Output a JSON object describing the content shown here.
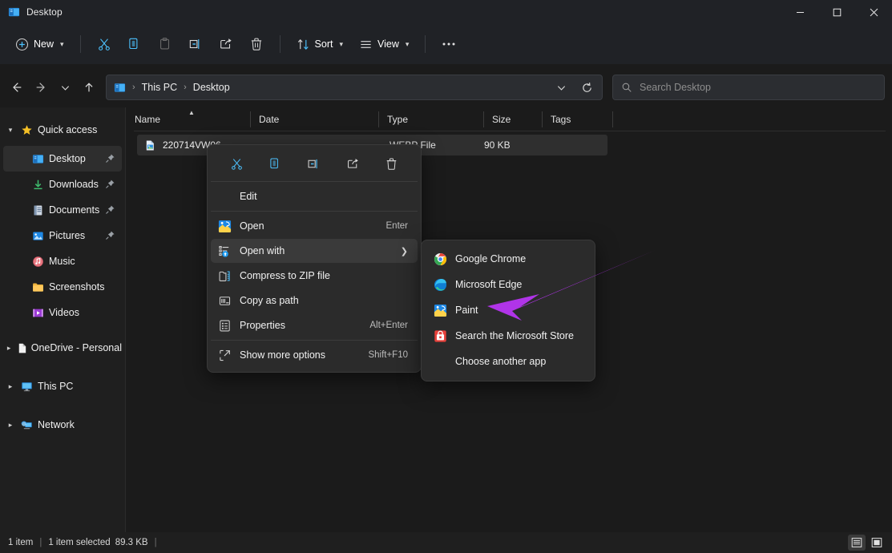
{
  "window": {
    "title": "Desktop",
    "app_icon": "desktop-folder-icon",
    "controls": {
      "minimize": "Minimize",
      "maximize": "Maximize",
      "close": "Close"
    }
  },
  "toolbar": {
    "new_label": "New",
    "items": [
      {
        "name": "cut",
        "label": "Cut"
      },
      {
        "name": "copy",
        "label": "Copy"
      },
      {
        "name": "paste",
        "label": "Paste"
      },
      {
        "name": "rename",
        "label": "Rename"
      },
      {
        "name": "share",
        "label": "Share"
      },
      {
        "name": "delete",
        "label": "Delete"
      }
    ],
    "sort_label": "Sort",
    "view_label": "View",
    "more_label": "See more"
  },
  "addressbar": {
    "back": "Back",
    "forward": "Forward",
    "recent": "Recent locations",
    "up": "Up to This PC",
    "crumbs": [
      "This PC",
      "Desktop"
    ],
    "separator": "›",
    "dropdown": "Previous locations",
    "refresh": "Refresh"
  },
  "search": {
    "placeholder": "Search Desktop",
    "icon": "search-icon"
  },
  "sidebar": {
    "groups": [
      {
        "name": "quick-access",
        "label": "Quick access",
        "icon": "star-icon",
        "expanded": true,
        "items": [
          {
            "label": "Desktop",
            "icon": "desktop-icon",
            "pinned": true,
            "selected": true
          },
          {
            "label": "Downloads",
            "icon": "download-icon",
            "pinned": true,
            "selected": false
          },
          {
            "label": "Documents",
            "icon": "documents-icon",
            "pinned": true,
            "selected": false
          },
          {
            "label": "Pictures",
            "icon": "pictures-icon",
            "pinned": true,
            "selected": false
          },
          {
            "label": "Music",
            "icon": "music-icon",
            "pinned": false,
            "selected": false
          },
          {
            "label": "Screenshots",
            "icon": "folder-icon",
            "pinned": false,
            "selected": false
          },
          {
            "label": "Videos",
            "icon": "videos-icon",
            "pinned": false,
            "selected": false
          }
        ]
      },
      {
        "name": "onedrive",
        "label": "OneDrive - Personal",
        "icon": "onedrive-icon",
        "expanded": false,
        "items": []
      },
      {
        "name": "this-pc",
        "label": "This PC",
        "icon": "thispc-icon",
        "expanded": false,
        "items": []
      },
      {
        "name": "network",
        "label": "Network",
        "icon": "network-icon",
        "expanded": false,
        "items": []
      }
    ]
  },
  "filelist": {
    "columns": [
      {
        "label": "Name",
        "sorted": true,
        "sort_dir": "asc"
      },
      {
        "label": "Date",
        "sorted": false
      },
      {
        "label": "Type",
        "sorted": false
      },
      {
        "label": "Size",
        "sorted": false
      },
      {
        "label": "Tags",
        "sorted": false
      }
    ],
    "rows": [
      {
        "name": "220714VW06",
        "icon": "webp-file-icon",
        "type": "WEBP File",
        "size": "90 KB",
        "tags": "",
        "selected": true
      }
    ]
  },
  "context_menu": {
    "toolbar": [
      {
        "name": "cut",
        "label": "Cut"
      },
      {
        "name": "copy",
        "label": "Copy"
      },
      {
        "name": "rename",
        "label": "Rename"
      },
      {
        "name": "share",
        "label": "Share"
      },
      {
        "name": "delete",
        "label": "Delete"
      }
    ],
    "items": [
      {
        "label": "Edit",
        "icon": "",
        "accel": "",
        "submenu": false,
        "highlighted": false,
        "divider_after": true
      },
      {
        "label": "Open",
        "icon": "paint-icon",
        "accel": "Enter",
        "submenu": false,
        "highlighted": false,
        "divider_after": false
      },
      {
        "label": "Open with",
        "icon": "open-with-icon",
        "accel": "",
        "submenu": true,
        "highlighted": true,
        "divider_after": false
      },
      {
        "label": "Compress to ZIP file",
        "icon": "zip-icon",
        "accel": "",
        "submenu": false,
        "highlighted": false,
        "divider_after": false
      },
      {
        "label": "Copy as path",
        "icon": "copy-path-icon",
        "accel": "",
        "submenu": false,
        "highlighted": false,
        "divider_after": false
      },
      {
        "label": "Properties",
        "icon": "properties-icon",
        "accel": "Alt+Enter",
        "submenu": false,
        "highlighted": false,
        "divider_after": true
      },
      {
        "label": "Show more options",
        "icon": "more-options-icon",
        "accel": "Shift+F10",
        "submenu": false,
        "highlighted": false,
        "divider_after": false
      }
    ]
  },
  "submenu": {
    "items": [
      {
        "label": "Google Chrome",
        "icon": "chrome-icon"
      },
      {
        "label": "Microsoft Edge",
        "icon": "edge-icon"
      },
      {
        "label": "Paint",
        "icon": "paint-icon"
      },
      {
        "label": "Search the Microsoft Store",
        "icon": "store-icon"
      },
      {
        "label": "Choose another app",
        "icon": ""
      }
    ]
  },
  "annotation": {
    "type": "arrow",
    "color": "#b034e8",
    "points_at": "Paint"
  },
  "statusbar": {
    "item_count": "1 item",
    "selection": "1 item selected",
    "selection_size": "89.3 KB",
    "views": [
      {
        "name": "details-view",
        "active": true
      },
      {
        "name": "large-icons-view",
        "active": false
      }
    ]
  },
  "colors": {
    "titlebar": "#202226",
    "content": "#1b1b1b",
    "sidebar": "#1f1f1f",
    "menu": "#2b2b2b",
    "accent": "#4cc2ff",
    "annotation": "#b034e8"
  }
}
